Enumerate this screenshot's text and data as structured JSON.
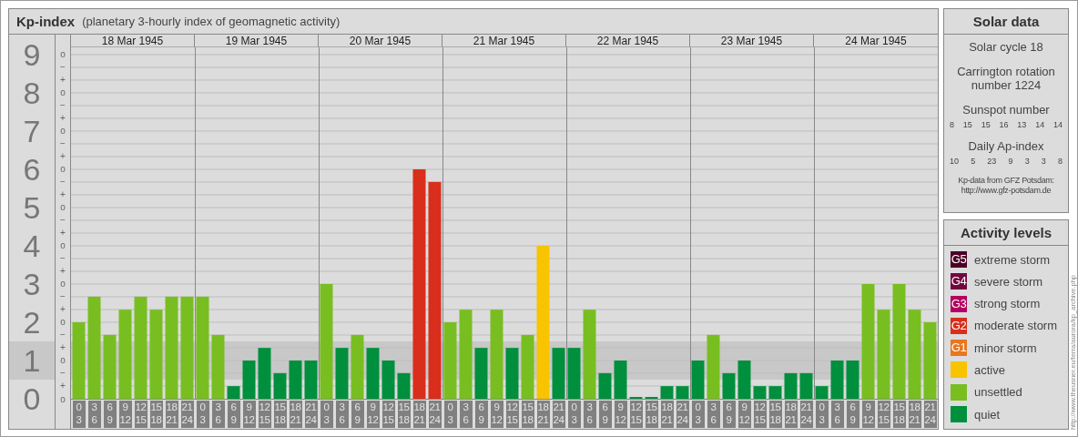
{
  "kp_panel": {
    "title": "Kp-index",
    "subtitle": "(planetary 3-hourly index of geomagnetic activity)",
    "days": [
      "18 Mar 1945",
      "19 Mar 1945",
      "20 Mar 1945",
      "21 Mar 1945",
      "22 Mar 1945",
      "23 Mar 1945",
      "24 Mar 1945"
    ],
    "scale_marks": [
      "o",
      "−",
      "+",
      "o",
      "−",
      "+",
      "o",
      "−",
      "+",
      "o",
      "−",
      "+",
      "o",
      "−",
      "+",
      "o",
      "−",
      "+",
      "o",
      "−",
      "+",
      "o",
      "−",
      "+",
      "o",
      "−",
      "+",
      "o"
    ],
    "chart_data": {
      "type": "bar",
      "grid": true,
      "ylim": [
        0,
        9.19
      ],
      "yticks": [
        0,
        1,
        2,
        3,
        4,
        5,
        6,
        7,
        8,
        9
      ],
      "categories": [
        "0\n3",
        "3\n6",
        "6\n9",
        "9\n12",
        "12\n15",
        "15\n18",
        "18\n21",
        "21\n24",
        "0\n3",
        "3\n6",
        "6\n9",
        "9\n12",
        "12\n15",
        "15\n18",
        "18\n21",
        "21\n24",
        "0\n3",
        "3\n6",
        "6\n9",
        "9\n12",
        "12\n15",
        "15\n18",
        "18\n21",
        "21\n24",
        "0\n3",
        "3\n6",
        "6\n9",
        "9\n12",
        "12\n15",
        "15\n18",
        "18\n21",
        "21\n24",
        "0\n3",
        "3\n6",
        "6\n9",
        "9\n12",
        "12\n15",
        "15\n18",
        "18\n21",
        "21\n24",
        "0\n3",
        "3\n6",
        "6\n9",
        "9\n12",
        "12\n15",
        "15\n18",
        "18\n21",
        "21\n24",
        "0\n3",
        "3\n6",
        "6\n9",
        "9\n12",
        "12\n15",
        "15\n18",
        "18\n21",
        "21\n24"
      ],
      "series": [
        {
          "name": "extreme storm",
          "color": "#4d0026",
          "values": [
            null,
            null,
            null,
            null,
            null,
            null,
            null,
            null,
            null,
            null,
            null,
            null,
            null,
            null,
            null,
            null,
            null,
            null,
            null,
            null,
            null,
            null,
            null,
            null,
            null,
            null,
            null,
            null,
            null,
            null,
            null,
            null,
            null,
            null,
            null,
            null,
            null,
            null,
            null,
            null,
            null,
            null,
            null,
            null,
            null,
            null,
            null,
            null,
            null,
            null,
            null,
            null,
            null,
            null,
            null,
            null
          ]
        },
        {
          "name": "severe storm",
          "color": "#72073f",
          "values": [
            null,
            null,
            null,
            null,
            null,
            null,
            null,
            null,
            null,
            null,
            null,
            null,
            null,
            null,
            null,
            null,
            null,
            null,
            null,
            null,
            null,
            null,
            null,
            null,
            null,
            null,
            null,
            null,
            null,
            null,
            null,
            null,
            null,
            null,
            null,
            null,
            null,
            null,
            null,
            null,
            null,
            null,
            null,
            null,
            null,
            null,
            null,
            null,
            null,
            null,
            null,
            null,
            null,
            null,
            null,
            null
          ]
        },
        {
          "name": "strong storm",
          "color": "#b3005f",
          "values": [
            null,
            null,
            null,
            null,
            null,
            null,
            null,
            null,
            null,
            null,
            null,
            null,
            null,
            null,
            null,
            null,
            null,
            null,
            null,
            null,
            null,
            null,
            null,
            null,
            null,
            null,
            null,
            null,
            null,
            null,
            null,
            null,
            null,
            null,
            null,
            null,
            null,
            null,
            null,
            null,
            null,
            null,
            null,
            null,
            null,
            null,
            null,
            null,
            null,
            null,
            null,
            null,
            null,
            null,
            null,
            null
          ]
        },
        {
          "name": "moderate storm",
          "color": "#d92e1c",
          "values": [
            null,
            null,
            null,
            null,
            null,
            null,
            null,
            null,
            null,
            null,
            null,
            null,
            null,
            null,
            null,
            null,
            null,
            null,
            null,
            null,
            null,
            null,
            6,
            5.67,
            null,
            null,
            null,
            null,
            null,
            null,
            null,
            null,
            null,
            null,
            null,
            null,
            null,
            null,
            null,
            null,
            null,
            null,
            null,
            null,
            null,
            null,
            null,
            null,
            null,
            null,
            null,
            null,
            null,
            null,
            null,
            null
          ]
        },
        {
          "name": "minor storm",
          "color": "#e8771f",
          "values": [
            null,
            null,
            null,
            null,
            null,
            null,
            null,
            null,
            null,
            null,
            null,
            null,
            null,
            null,
            null,
            null,
            null,
            null,
            null,
            null,
            null,
            null,
            null,
            null,
            null,
            null,
            null,
            null,
            null,
            null,
            null,
            null,
            null,
            null,
            null,
            null,
            null,
            null,
            null,
            null,
            null,
            null,
            null,
            null,
            null,
            null,
            null,
            null,
            null,
            null,
            null,
            null,
            null,
            null,
            null,
            null
          ]
        },
        {
          "name": "active",
          "color": "#f8c400",
          "values": [
            null,
            null,
            null,
            null,
            null,
            null,
            null,
            null,
            null,
            null,
            null,
            null,
            null,
            null,
            null,
            null,
            null,
            null,
            null,
            null,
            null,
            null,
            null,
            null,
            null,
            null,
            null,
            null,
            null,
            null,
            4,
            null,
            null,
            null,
            null,
            null,
            null,
            null,
            null,
            null,
            null,
            null,
            null,
            null,
            null,
            null,
            null,
            null,
            null,
            null,
            null,
            null,
            null,
            null,
            null,
            null
          ]
        },
        {
          "name": "unsettled",
          "color": "#78be21",
          "values": [
            2,
            2.67,
            1.67,
            2.33,
            2.67,
            2.33,
            2.67,
            2.67,
            2.67,
            1.67,
            null,
            null,
            null,
            null,
            null,
            null,
            3,
            null,
            1.67,
            null,
            null,
            null,
            null,
            null,
            2,
            2.33,
            null,
            2.33,
            null,
            1.67,
            null,
            null,
            null,
            2.33,
            null,
            null,
            null,
            null,
            null,
            null,
            null,
            1.67,
            null,
            null,
            null,
            null,
            null,
            null,
            null,
            null,
            null,
            3,
            2.33,
            3,
            2.33,
            2
          ]
        },
        {
          "name": "quiet",
          "color": "#008f3c",
          "values": [
            null,
            null,
            null,
            null,
            null,
            null,
            null,
            null,
            null,
            null,
            0.33,
            1,
            1.33,
            0.67,
            1,
            1,
            null,
            1.33,
            null,
            1.33,
            1,
            0.67,
            null,
            null,
            null,
            null,
            1.33,
            null,
            1.33,
            null,
            null,
            1.33,
            1.33,
            null,
            0.67,
            1,
            0,
            0,
            0.33,
            0.33,
            1,
            null,
            0.67,
            1,
            0.33,
            0.33,
            0.67,
            0.67,
            0.33,
            1,
            1,
            null,
            null,
            null,
            null,
            null
          ]
        }
      ]
    }
  },
  "solar_panel": {
    "title": "Solar data",
    "items": [
      {
        "kind": "text",
        "text": "Solar cycle 18"
      },
      {
        "kind": "text",
        "text": "Carrington rotation number 1224"
      },
      {
        "kind": "heading",
        "text": "Sunspot number"
      },
      {
        "kind": "numbers",
        "values": [
          "8",
          "15",
          "15",
          "16",
          "13",
          "14",
          "14"
        ]
      },
      {
        "kind": "heading",
        "text": "Daily Ap-index"
      },
      {
        "kind": "numbers",
        "values": [
          "10",
          "5",
          "23",
          "9",
          "3",
          "3",
          "8"
        ]
      },
      {
        "kind": "note",
        "text": "Kp-data from GFZ Potsdam:",
        "link": "http://www.gfz-potsdam.de"
      }
    ]
  },
  "legend": {
    "title": "Activity levels",
    "codes": [
      "G5",
      "G4",
      "G3",
      "G2",
      "G1"
    ]
  },
  "credit": "http://www.theusner.eu/terra/aurora/kp_archive.php"
}
